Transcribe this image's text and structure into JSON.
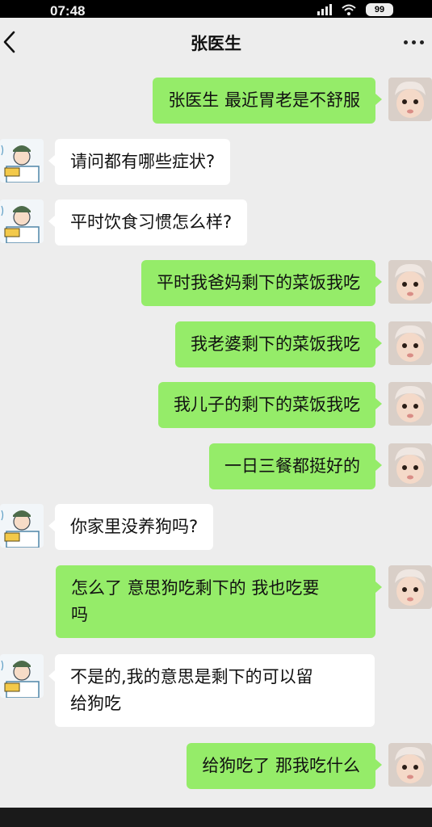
{
  "status_bar": {
    "time": "07:48",
    "battery": "99"
  },
  "nav": {
    "title": "张医生",
    "back_icon": "chevron-left-icon",
    "more_icon": "more-dots-icon"
  },
  "colors": {
    "sent_bubble": "#95ec69",
    "received_bubble": "#ffffff",
    "background": "#ededed"
  },
  "messages": [
    {
      "from": "me",
      "text": "张医生 最近胃老是不舒服"
    },
    {
      "from": "doctor",
      "text": "请问都有哪些症状?"
    },
    {
      "from": "doctor",
      "text": "平时饮食习惯怎么样?"
    },
    {
      "from": "me",
      "text": "平时我爸妈剩下的菜饭我吃"
    },
    {
      "from": "me",
      "text": "我老婆剩下的菜饭我吃"
    },
    {
      "from": "me",
      "text": "我儿子的剩下的菜饭我吃"
    },
    {
      "from": "me",
      "text": "一日三餐都挺好的"
    },
    {
      "from": "doctor",
      "text": "你家里没养狗吗?"
    },
    {
      "from": "me",
      "text": "怎么了 意思狗吃剩下的 我也吃要\n吗"
    },
    {
      "from": "doctor",
      "text": "不是的,我的意思是剩下的可以留\n给狗吃"
    },
    {
      "from": "me",
      "text": "给狗吃了 那我吃什么"
    }
  ]
}
